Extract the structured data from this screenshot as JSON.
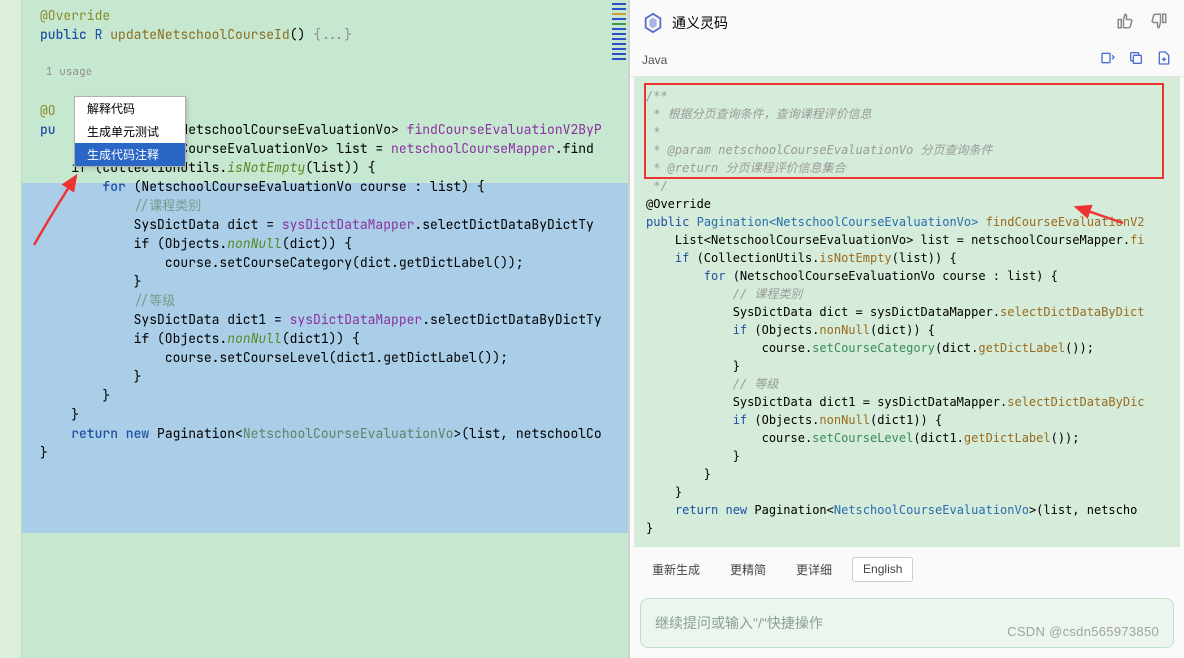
{
  "left": {
    "override": "@Override",
    "method_sig": {
      "pub": "public",
      "ret": "R",
      "name": "updateNetschoolCourseId",
      "parens": "()",
      "fold": "{...}"
    },
    "usage": "1 usage",
    "context_menu": [
      "解释代码",
      "生成单元测试",
      "生成代码注释"
    ],
    "lines": {
      "pu_frag": "pu",
      "gt_frag": "CourseEvaluationVo>",
      "method2": "findCourseEvaluationV2ByP",
      "type2": "NetschoolCourseEvaluationVo>",
      "list_decl": "list =",
      "mapper": "netschoolCourseMapper",
      "find": ".find",
      "if_open": "if (CollectionUtils.",
      "isNotEmpty": "isNotEmpty",
      "if_close": "(list)) {",
      "for_line": "for (NetschoolCourseEvaluationVo course : list) {",
      "c_cat": "//课程类别",
      "dict_decl": "SysDictData dict = ",
      "sys_mapper": "sysDictDataMapper",
      "selectDict": ".selectDictDataByDictTy",
      "if_nonnull": "if (Objects.",
      "nonNull": "nonNull",
      "if_nn_close": "(dict)) {",
      "set_cat": "course.setCourseCategory(dict.getDictLabel());",
      "close_brace": "}",
      "c_level": "//等级",
      "dict1_decl": "SysDictData dict1 = ",
      "selectDict1": ".selectDictDataByDictTy",
      "if_nn1_close": "(dict1)) {",
      "set_level": "course.setCourseLevel(dict1.getDictLabel());",
      "return_kw": "return new",
      "pagination": "Pagination<",
      "vo": "NetschoolCourseEvaluationVo",
      "ret_tail": ">(list, netschoolCo"
    }
  },
  "right": {
    "ai_name": "通义灵码",
    "lang": "Java",
    "doc": {
      "l1": "/**",
      "l2": " * 根据分页查询条件，查询课程评价信息",
      "l3": " *",
      "l4": " * @param netschoolCourseEvaluationVo 分页查询条件",
      "l5": " * @return 分页课程评价信息集合",
      "l6": " */"
    },
    "code": {
      "override": "@Override",
      "pub": "public",
      "pag_open": "Pagination<NetschoolCourseEvaluationVo>",
      "method": "findCourseEvaluationV2",
      "list_decl": "List<NetschoolCourseEvaluationVo> list = netschoolCourseMapper.",
      "fi": "fi",
      "if_pre": "if (CollectionUtils.",
      "isNotEmpty": "isNotEmpty",
      "if_close": "(list)) {",
      "for_kw": "for",
      "for_rest": " (NetschoolCourseEvaluationVo course : list) {",
      "c_cat": "// 课程类别",
      "dict_decl": "SysDictData dict = sysDictDataMapper.",
      "selByDict": "selectDictDataByDict",
      "if_nn": "if (Objects.",
      "nonNull": "nonNull",
      "nn_close": "(dict)) {",
      "course_pre": "course.",
      "setCat": "setCourseCategory",
      "dict_get": "(dict.",
      "getLabel": "getDictLabel",
      "tail": "());",
      "brace": "}",
      "c_level": "// 等级",
      "dict1_decl": "SysDictData dict1 = sysDictDataMapper.",
      "selByDic1": "selectDictDataByDic",
      "nn1_close": "(dict1)) {",
      "setLevel": "setCourseLevel",
      "dict1_get": "(dict1.",
      "ret_kw": "return new",
      "pag": "Pagination<",
      "vo": "NetschoolCourseEvaluationVo",
      "ret_tail": ">(list, netscho"
    },
    "buttons": [
      "重新生成",
      "更精简",
      "更详细",
      "English"
    ],
    "input_placeholder": "继续提问或输入\"/\"快捷操作",
    "watermark": "CSDN @csdn565973850"
  }
}
